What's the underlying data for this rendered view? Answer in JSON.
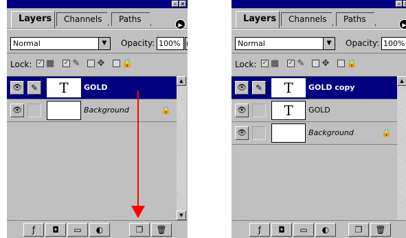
{
  "colors": {
    "selection": "#000080",
    "annotation_arrow": "#ff0000",
    "panel_bg": "#c0c0c0"
  },
  "palettes": [
    {
      "id": "before",
      "tabs": [
        "Layers",
        "Channels",
        "Paths"
      ],
      "blend_mode": "Normal",
      "opacity_label": "Opacity:",
      "opacity_value": "100%",
      "lock_label": "Lock:",
      "layers": [
        {
          "name": "GOLD",
          "thumb": "T",
          "selected": true,
          "locked": false
        },
        {
          "name": "Background",
          "thumb": "",
          "selected": false,
          "locked": true
        }
      ],
      "buttons": [
        "layer-style-icon",
        "mask-icon",
        "folder-icon",
        "adjustment-layer-icon",
        "new-layer-icon",
        "trash-icon"
      ]
    },
    {
      "id": "after",
      "tabs": [
        "Layers",
        "Channels",
        "Paths"
      ],
      "blend_mode": "Normal",
      "opacity_label": "Opacity:",
      "opacity_value": "100%",
      "lock_label": "Lock:",
      "layers": [
        {
          "name": "GOLD copy",
          "thumb": "T",
          "selected": true,
          "locked": false
        },
        {
          "name": "GOLD",
          "thumb": "T",
          "selected": false,
          "locked": false
        },
        {
          "name": "Background",
          "thumb": "",
          "selected": false,
          "locked": true
        }
      ],
      "buttons": [
        "layer-style-icon",
        "mask-icon",
        "folder-icon",
        "adjustment-layer-icon",
        "new-layer-icon",
        "trash-icon"
      ]
    }
  ]
}
